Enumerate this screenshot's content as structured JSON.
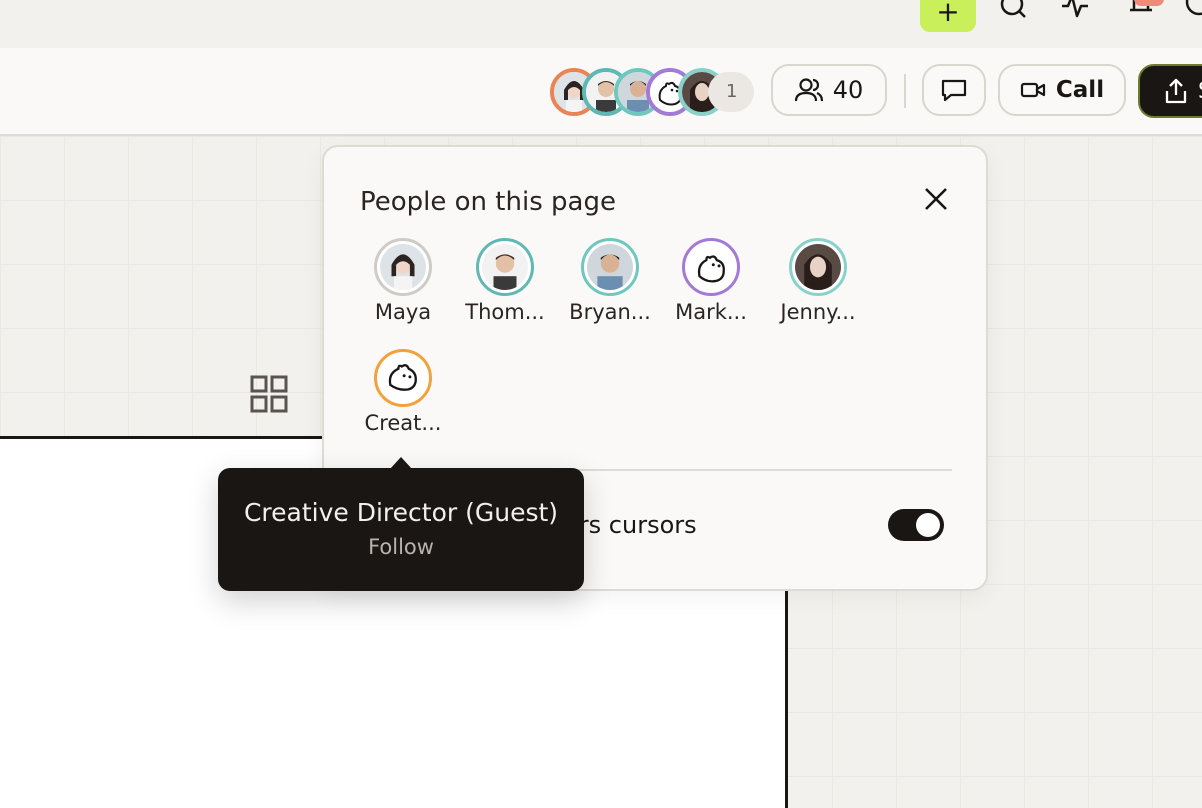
{
  "topbar": {
    "add_label": "+",
    "icons": [
      "search-icon",
      "activity-icon",
      "bell-icon",
      "help-icon"
    ]
  },
  "header": {
    "avatar_overflow_text": "1",
    "people_count": "40",
    "call_label": "Call",
    "share_label": "S"
  },
  "popover": {
    "title": "People on this page",
    "people": [
      {
        "name": "Maya",
        "ring_color": "#cfcbc6"
      },
      {
        "name": "Thom...",
        "ring_color": "#5fb8b4"
      },
      {
        "name": "Bryan...",
        "ring_color": "#6fc7bd"
      },
      {
        "name": "Mark...",
        "ring_color": "#a37ad6"
      },
      {
        "name": "Jenny...",
        "ring_color": "#8ad2c9"
      },
      {
        "name": "Creat...",
        "ring_color": "#f2a13b"
      }
    ],
    "cursors_label": "ators cursors",
    "cursors_toggle_on": true
  },
  "tooltip": {
    "title": "Creative Director (Guest)",
    "action": "Follow"
  },
  "colors": {
    "accent_green": "#c9ef5a",
    "dark": "#1a1614",
    "badge": "#f08a7b"
  }
}
